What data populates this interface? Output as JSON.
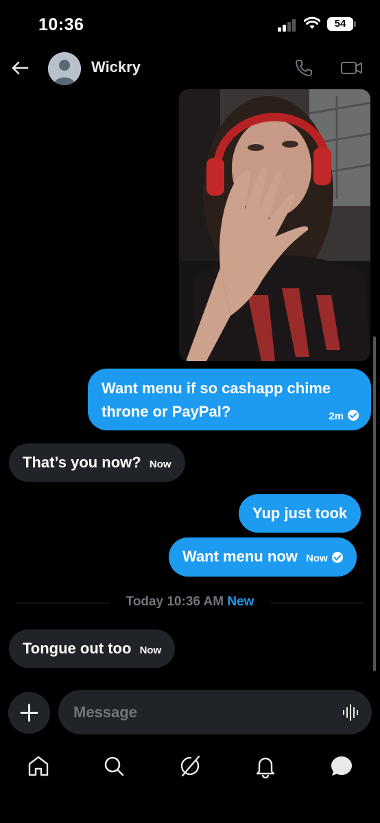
{
  "status_bar": {
    "time": "10:36",
    "battery": "54"
  },
  "header": {
    "contact_name": "Wickry"
  },
  "messages": [
    {
      "text": "Want menu if so cashapp chime throne or PayPal?",
      "time": "2m"
    },
    {
      "text": "That’s you now?",
      "time": "Now"
    },
    {
      "text": "Yup just took"
    },
    {
      "text": "Want menu now",
      "time": "Now"
    },
    {
      "text": "Tongue out too",
      "time": "Now"
    }
  ],
  "divider": {
    "label": "Today 10:36 AM",
    "badge": "New"
  },
  "composer": {
    "placeholder": "Message"
  },
  "nav": {
    "items": [
      "home-icon",
      "search-icon",
      "grok-icon",
      "notifications-icon",
      "messages-icon"
    ]
  },
  "colors": {
    "accent": "#1d9bf0",
    "received_bubble": "#202327",
    "background": "#000000",
    "muted": "#71767b"
  }
}
